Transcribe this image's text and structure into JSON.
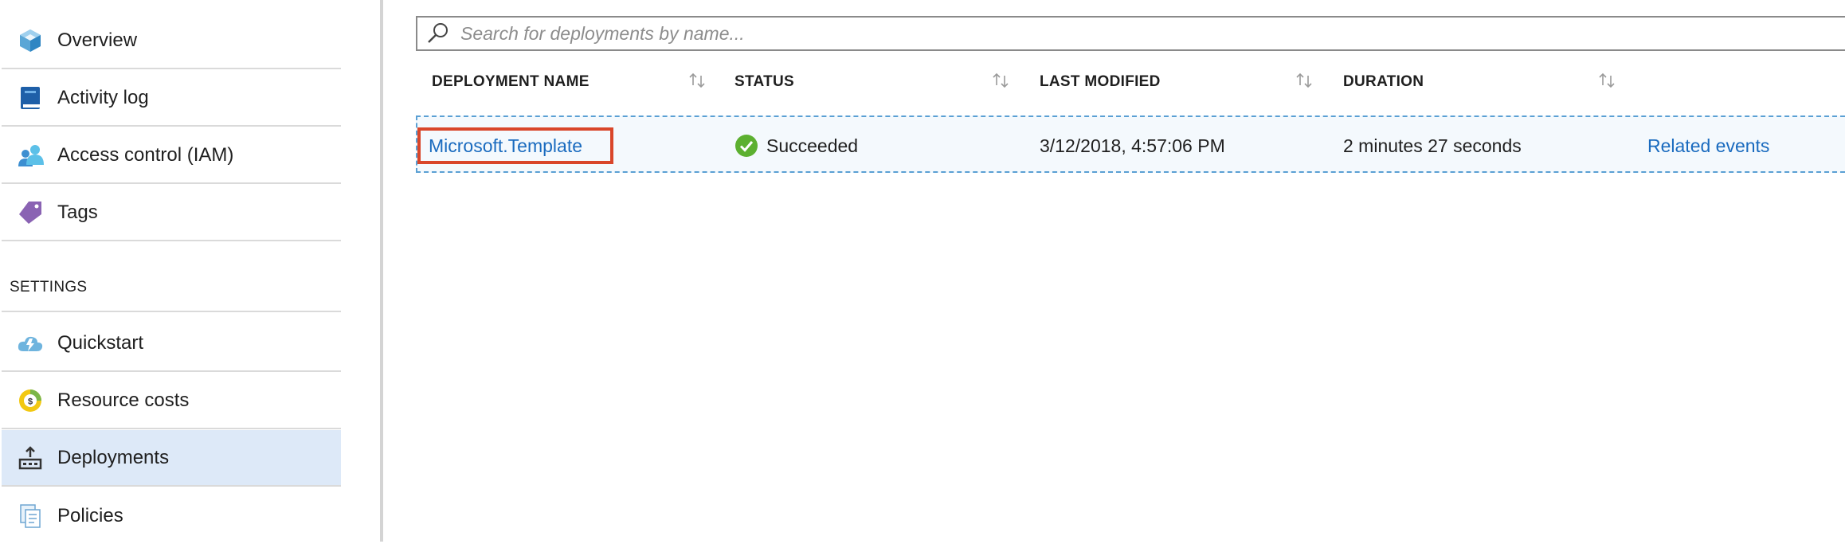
{
  "sidebar": {
    "items_top": [
      {
        "label": "Overview",
        "icon": "resource-group-cube-icon"
      },
      {
        "label": "Activity log",
        "icon": "activity-log-book-icon"
      },
      {
        "label": "Access control (IAM)",
        "icon": "users-access-icon"
      },
      {
        "label": "Tags",
        "icon": "tag-icon"
      }
    ],
    "settings_header": "SETTINGS",
    "items_settings": [
      {
        "label": "Quickstart",
        "icon": "quickstart-cloud-icon"
      },
      {
        "label": "Resource costs",
        "icon": "resource-costs-icon"
      },
      {
        "label": "Deployments",
        "icon": "deployments-icon",
        "selected": true
      },
      {
        "label": "Policies",
        "icon": "policies-icon"
      }
    ]
  },
  "search": {
    "placeholder": "Search for deployments by name...",
    "value": ""
  },
  "table": {
    "columns": [
      "DEPLOYMENT NAME",
      "STATUS",
      "LAST MODIFIED",
      "DURATION"
    ],
    "rows": [
      {
        "name": "Microsoft.Template",
        "status": "Succeeded",
        "last_modified": "3/12/2018, 4:57:06 PM",
        "duration": "2 minutes 27 seconds",
        "action": "Related events"
      }
    ]
  },
  "colors": {
    "link": "#1a6bbf",
    "highlight_box": "#d9462a",
    "selected_nav": "#dde9f8",
    "success": "#5cb030"
  }
}
